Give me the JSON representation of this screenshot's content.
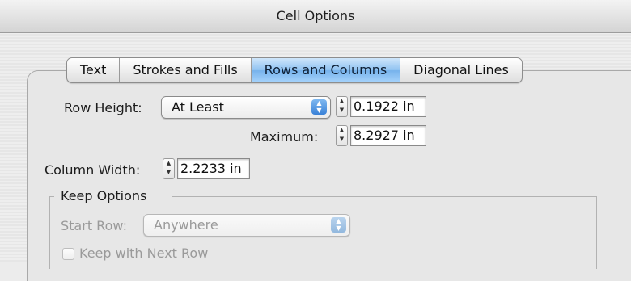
{
  "window": {
    "title": "Cell Options"
  },
  "tabs": [
    {
      "label": "Text",
      "selected": false
    },
    {
      "label": "Strokes and Fills",
      "selected": false
    },
    {
      "label": "Rows and Columns",
      "selected": true
    },
    {
      "label": "Diagonal Lines",
      "selected": false
    }
  ],
  "row_height": {
    "label": "Row Height:",
    "mode": "At Least",
    "value": "0.1922 in"
  },
  "maximum": {
    "label": "Maximum:",
    "value": "8.2927 in"
  },
  "column_width": {
    "label": "Column Width:",
    "value": "2.2233 in"
  },
  "keep_options": {
    "title": "Keep Options",
    "start_row_label": "Start Row:",
    "start_row_value": "Anywhere",
    "keep_with_next_label": "Keep with Next Row"
  },
  "icons": {
    "popup_arrows": "up-down-arrows-icon",
    "stepper": "stepper-arrows-icon"
  },
  "colors": {
    "selected_tab": "#8fc2f1",
    "popup_arrow": "#3a82d8"
  }
}
